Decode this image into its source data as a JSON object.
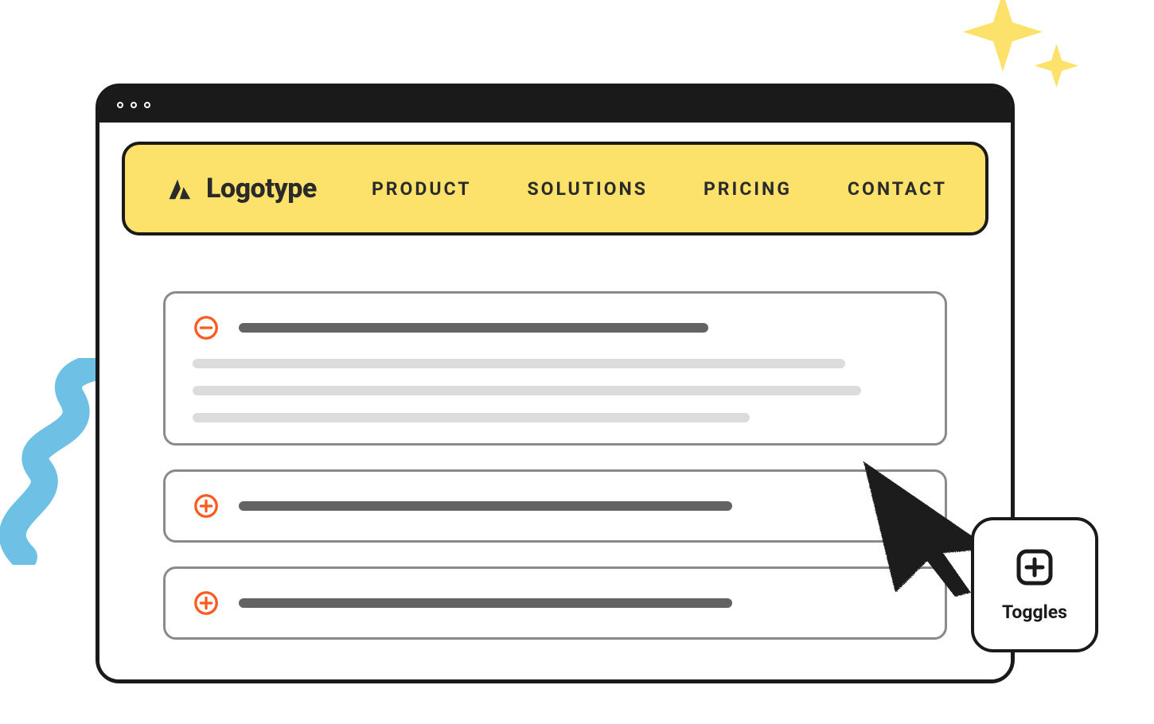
{
  "header": {
    "logo_text": "Logotype",
    "nav": [
      "PRODUCT",
      "SOLUTIONS",
      "PRICING",
      "CONTACT"
    ]
  },
  "accordion": {
    "items": [
      {
        "expanded": true
      },
      {
        "expanded": false
      },
      {
        "expanded": false
      }
    ]
  },
  "badge": {
    "label": "Toggles"
  }
}
